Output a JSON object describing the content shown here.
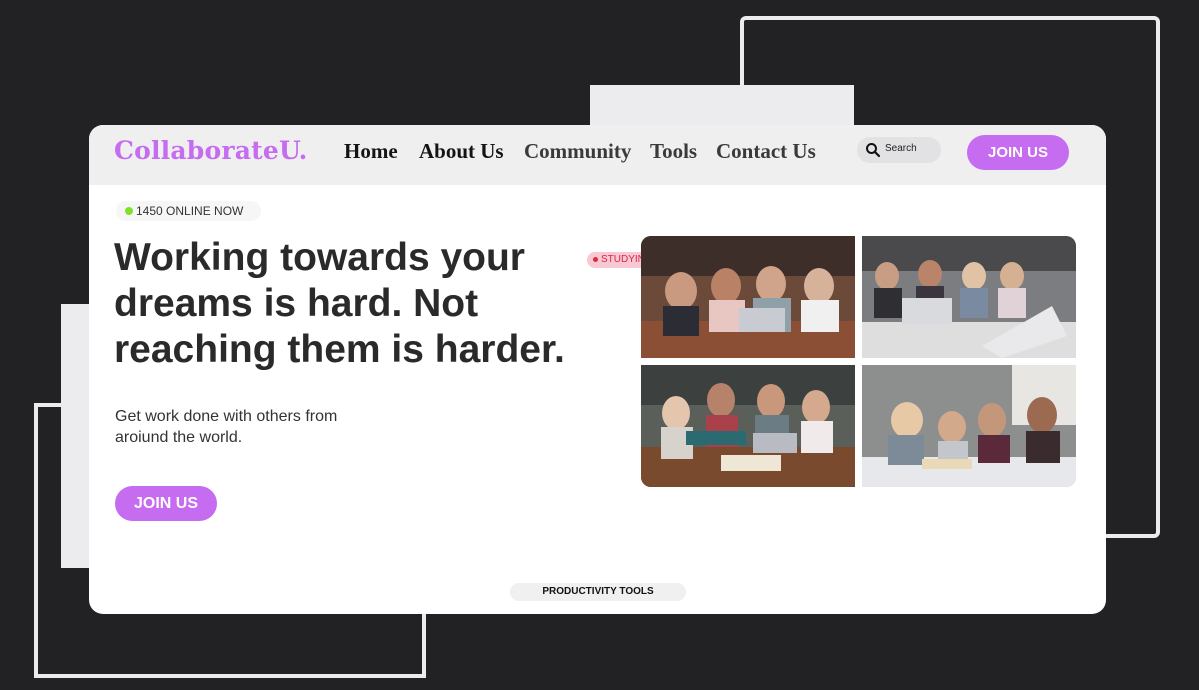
{
  "brand": {
    "logo": "CollaborateU.",
    "accent_color": "#c56cf0"
  },
  "nav": {
    "links": [
      "Home",
      "About Us",
      "Community",
      "Tools",
      "Contact Us"
    ],
    "search_placeholder": "Search",
    "join_label": "JOIN US"
  },
  "hero": {
    "online_badge": "1450 ONLINE NOW",
    "headline": "Working towards your dreams is hard. Not reaching them is harder.",
    "subtext": "Get work done with others from aroiund the world.",
    "join_label": "JOIN US",
    "live_badge": "STUDYING LIVE",
    "photos": [
      {
        "icon": "photo-group-studying-icon"
      },
      {
        "icon": "photo-group-laptop-icon"
      },
      {
        "icon": "photo-group-books-icon"
      },
      {
        "icon": "photo-group-reading-icon"
      }
    ]
  },
  "footer": {
    "section_tag": "PRODUCTIVITY TOOLS"
  },
  "colors": {
    "background": "#222224",
    "card": "#ffffff",
    "nav_bg": "#efeff0",
    "live_dot": "#e0283f",
    "online_dot": "#7ee228"
  }
}
